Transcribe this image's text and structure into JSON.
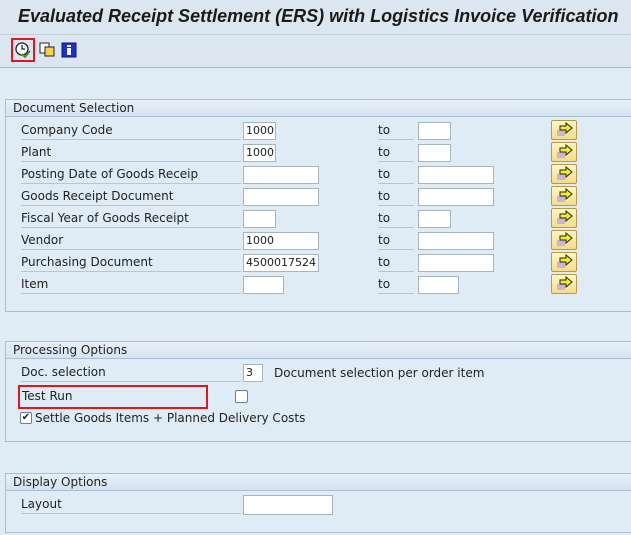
{
  "title": "Evaluated Receipt Settlement (ERS) with Logistics Invoice Verification",
  "toolbar": {
    "execute_icon": "clock-check-icon",
    "variants_icon": "get-variant-icon",
    "info_icon": "info-icon"
  },
  "document_selection": {
    "header": "Document Selection",
    "to_label": "to",
    "rows": [
      {
        "label": "Company Code",
        "from": "1000",
        "to": ""
      },
      {
        "label": "Plant",
        "from": "1000",
        "to": ""
      },
      {
        "label": "Posting Date of Goods Receip",
        "from": "",
        "to": ""
      },
      {
        "label": "Goods Receipt Document",
        "from": "",
        "to": ""
      },
      {
        "label": "Fiscal Year of Goods Receipt",
        "from": "",
        "to": ""
      },
      {
        "label": "Vendor",
        "from": "1000",
        "to": ""
      },
      {
        "label": "Purchasing Document",
        "from": "4500017524",
        "to": ""
      },
      {
        "label": "Item",
        "from": "",
        "to": ""
      }
    ]
  },
  "processing_options": {
    "header": "Processing Options",
    "doc_selection_label": "Doc. selection",
    "doc_selection_value": "3",
    "doc_selection_desc": "Document selection per order item",
    "test_run_label": "Test Run",
    "test_run_checked": false,
    "settle_label": "Settle Goods Items + Planned Delivery Costs",
    "settle_checked": true
  },
  "display_options": {
    "header": "Display Options",
    "layout_label": "Layout",
    "layout_value": ""
  }
}
